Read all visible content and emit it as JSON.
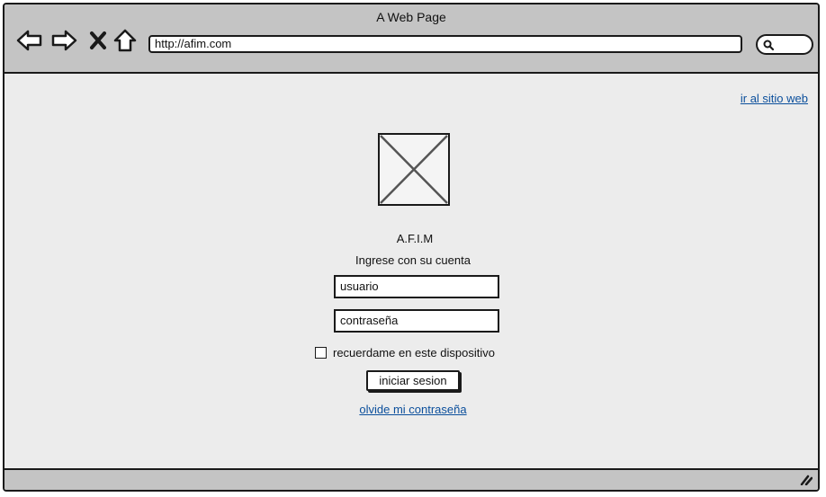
{
  "browser": {
    "window_title": "A Web Page",
    "url": "http://afim.com",
    "nav": {
      "back_icon": "arrow-left-icon",
      "forward_icon": "arrow-right-icon",
      "stop_icon": "close-icon",
      "home_icon": "home-icon",
      "search_icon": "search-icon"
    }
  },
  "page": {
    "site_link": "ir al sitio web",
    "logo_icon": "image-placeholder-icon",
    "brand": "A.F.I.M",
    "subtitle": "Ingrese con su cuenta",
    "username_value": "usuario",
    "password_value": "contraseña",
    "remember_label": "recuerdame en este dispositivo",
    "remember_checked": false,
    "login_label": "iniciar sesion",
    "forgot_link": "olvide mi contraseña"
  },
  "colors": {
    "chrome_bg": "#c4c4c4",
    "content_bg": "#ececec",
    "link": "#0b4f9c",
    "border": "#1a1a1a"
  }
}
